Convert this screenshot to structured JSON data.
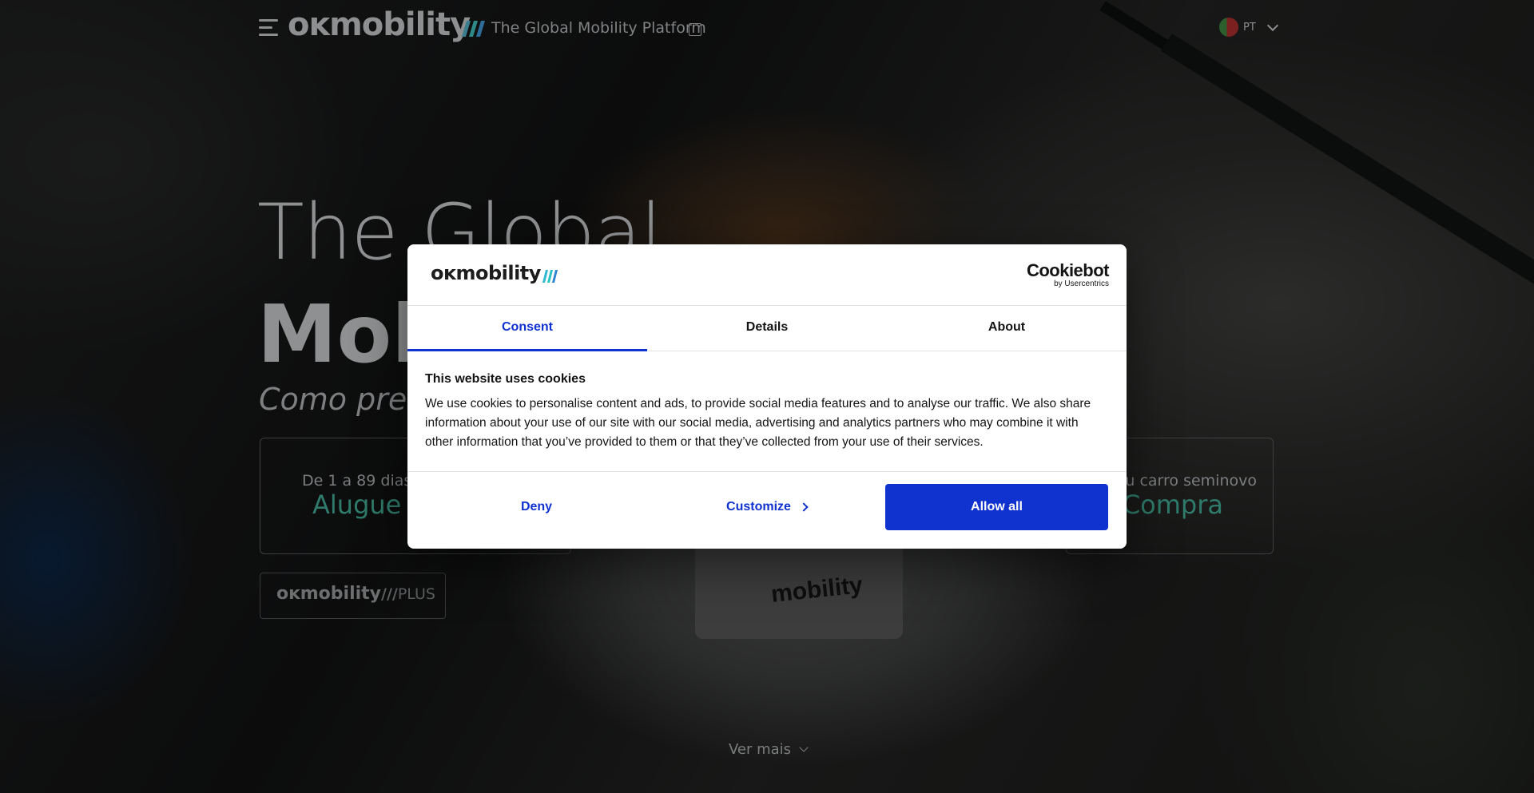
{
  "header": {
    "logo_text": "oĸmobility",
    "tagline": "The Global Mobility Platform",
    "language": "PT"
  },
  "hero": {
    "line1": "The Global",
    "line2": "Mob",
    "subtitle": "Como pret"
  },
  "options": [
    {
      "small": "De 1 a 89 dias",
      "big": "Alugue"
    },
    {
      "small": "eu carro seminovo",
      "big": "Compra"
    }
  ],
  "plus": {
    "logo": "oĸmobility",
    "suffix": "PLUS"
  },
  "see_more": "Ver mais",
  "cookie_dialog": {
    "logo_text": "oĸmobility",
    "provider_name": "Cookiebot",
    "provider_sub": "by Usercentrics",
    "tabs": [
      "Consent",
      "Details",
      "About"
    ],
    "active_tab": "Consent",
    "title": "This website uses cookies",
    "body": "We use cookies to personalise content and ads, to provide social media features and to analyse our traffic. We also share information about your use of our site with our social media, advertising and analytics partners who may combine it with other information that you’ve provided to them or that they’ve collected from your use of their services.",
    "deny_label": "Deny",
    "customize_label": "Customize",
    "allow_label": "Allow all"
  },
  "colors": {
    "accent_blue": "#1032cf",
    "teal": "#2f7a6a"
  }
}
